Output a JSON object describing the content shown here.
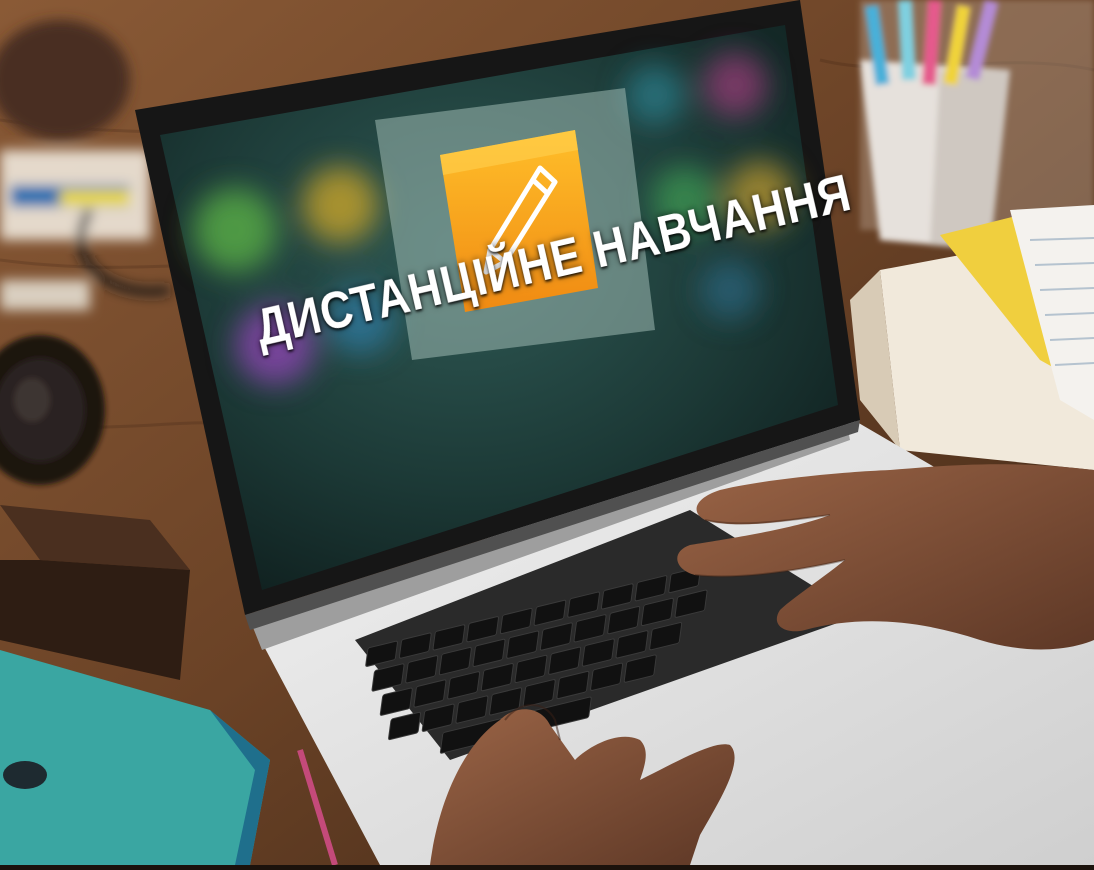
{
  "screen": {
    "title": "ДИСТАНЦІЙНЕ НАВЧАННЯ",
    "app_icon": "pencil-icon"
  },
  "colors": {
    "icon_orange": "#f7a41c",
    "icon_orange_dark": "#ee8a12",
    "desk_wood": "#6a4226",
    "screen_teal": "#1d3d3a",
    "notebook_teal": "#3aa6a2",
    "sticky_yellow": "#f0cf3e"
  }
}
